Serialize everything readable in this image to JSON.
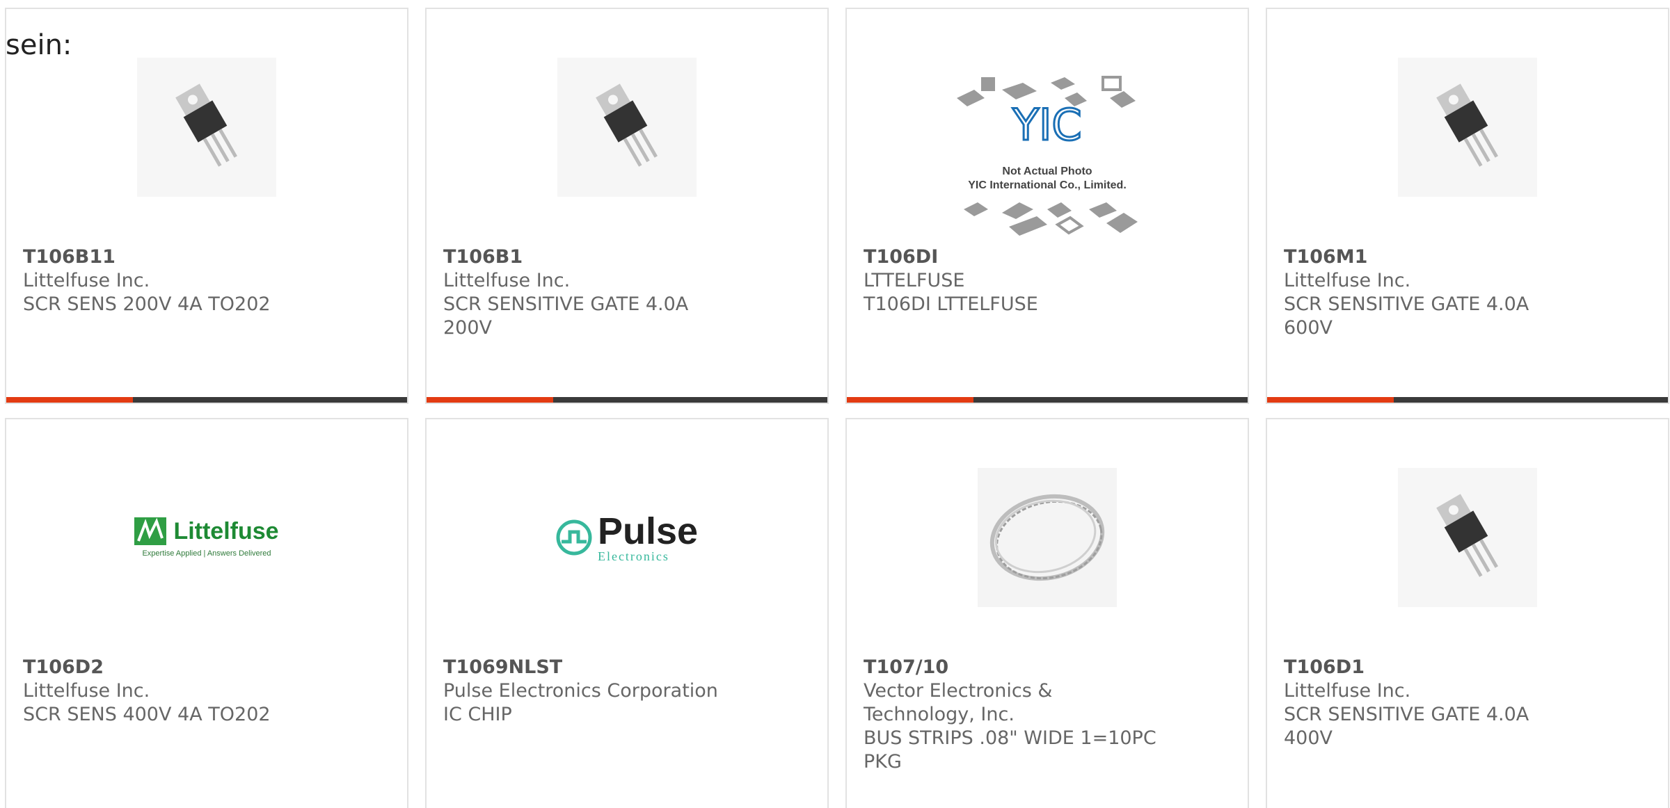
{
  "heading": "sein:",
  "products": [
    {
      "part": "T106B11",
      "manufacturer": "Littelfuse Inc.",
      "description": "SCR SENS 200V 4A TO202",
      "image": "transistor-to202-image"
    },
    {
      "part": "T106B1",
      "manufacturer": "Littelfuse Inc.",
      "description": "SCR SENSITIVE GATE 4.0A 200V",
      "image": "transistor-to202-image"
    },
    {
      "part": "T106DI",
      "manufacturer": "LTTELFUSE",
      "description": "T106DI LTTELFUSE",
      "image": "yic-placeholder-image",
      "placeholder_text": [
        "YIC",
        "Not Actual Photo",
        "YIC International Co., Limited."
      ]
    },
    {
      "part": "T106M1",
      "manufacturer": "Littelfuse Inc.",
      "description": "SCR SENSITIVE GATE 4.0A 600V",
      "image": "transistor-to202-image"
    },
    {
      "part": "T106D2",
      "manufacturer": "Littelfuse Inc.",
      "description": "SCR SENS 400V 4A TO202",
      "image": "littelfuse-logo-image",
      "logo_text": [
        "Littelfuse",
        "Expertise Applied | Answers Delivered"
      ]
    },
    {
      "part": "T1069NLST",
      "manufacturer": "Pulse Electronics Corporation",
      "description": "IC CHIP",
      "image": "pulse-electronics-logo-image",
      "logo_text": [
        "Pulse",
        "Electronics"
      ]
    },
    {
      "part": "T107/10",
      "manufacturer": "Vector Electronics & Technology, Inc.",
      "description": "BUS STRIPS .08\" WIDE 1=10PC PKG",
      "image": "bus-strip-coil-image"
    },
    {
      "part": "T106D1",
      "manufacturer": "Littelfuse Inc.",
      "description": "SCR SENSITIVE GATE 4.0A 400V",
      "image": "transistor-to202-image"
    }
  ],
  "colors": {
    "accent_red": "#e33b12",
    "accent_dark": "#3a3a3a",
    "text": "#666666",
    "border": "#e2e2e2"
  }
}
